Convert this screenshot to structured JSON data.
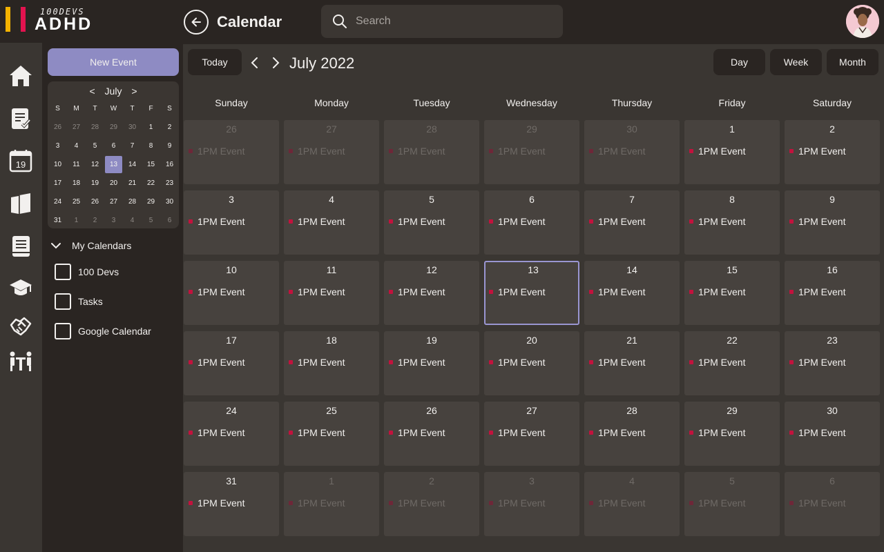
{
  "brand": {
    "small": "100DEVS",
    "big": "ADHD",
    "accent_yellow": "#f5b300",
    "accent_red": "#e3134f"
  },
  "header": {
    "title": "Calendar",
    "search_placeholder": "Search"
  },
  "rail": [
    "home-icon",
    "checklist-icon",
    "calendar-icon",
    "cards-icon",
    "book-icon",
    "graduation-cap-icon",
    "handshake-icon",
    "meeting-icon"
  ],
  "rail_calendar_number": "19",
  "sidebar": {
    "new_event": "New Event",
    "mini": {
      "month": "July",
      "prev": "<",
      "next": ">",
      "weekdays": [
        "S",
        "M",
        "T",
        "W",
        "T",
        "F",
        "S"
      ],
      "weeks": [
        [
          [
            "26",
            1
          ],
          [
            "27",
            1
          ],
          [
            "28",
            1
          ],
          [
            "29",
            1
          ],
          [
            "30",
            1
          ],
          [
            "1",
            0
          ],
          [
            "2",
            0
          ]
        ],
        [
          [
            "3",
            0
          ],
          [
            "4",
            0
          ],
          [
            "5",
            0
          ],
          [
            "6",
            0
          ],
          [
            "7",
            0
          ],
          [
            "8",
            0
          ],
          [
            "9",
            0
          ]
        ],
        [
          [
            "10",
            0
          ],
          [
            "11",
            0
          ],
          [
            "12",
            0
          ],
          [
            "13",
            2
          ],
          [
            "14",
            0
          ],
          [
            "15",
            0
          ],
          [
            "16",
            0
          ]
        ],
        [
          [
            "17",
            0
          ],
          [
            "18",
            0
          ],
          [
            "19",
            0
          ],
          [
            "20",
            0
          ],
          [
            "21",
            0
          ],
          [
            "22",
            0
          ],
          [
            "23",
            0
          ]
        ],
        [
          [
            "24",
            0
          ],
          [
            "25",
            0
          ],
          [
            "26",
            0
          ],
          [
            "27",
            0
          ],
          [
            "28",
            0
          ],
          [
            "29",
            0
          ],
          [
            "30",
            0
          ]
        ],
        [
          [
            "31",
            0
          ],
          [
            "1",
            1
          ],
          [
            "2",
            1
          ],
          [
            "3",
            1
          ],
          [
            "4",
            1
          ],
          [
            "5",
            1
          ],
          [
            "6",
            1
          ]
        ]
      ]
    },
    "my_calendars": "My Calendars",
    "calendars": [
      "100 Devs",
      "Tasks",
      "Google Calendar"
    ]
  },
  "toolbar": {
    "today": "Today",
    "month_title": "July 2022",
    "views": [
      "Day",
      "Week",
      "Month"
    ]
  },
  "weekdays": [
    "Sunday",
    "Monday",
    "Tuesday",
    "Wednesday",
    "Thursday",
    "Friday",
    "Saturday"
  ],
  "event_label": "1PM Event",
  "event_color": "#c2123d",
  "today_border": "#9a96d2",
  "weeks": [
    [
      [
        "26",
        1
      ],
      [
        "27",
        1
      ],
      [
        "28",
        1
      ],
      [
        "29",
        1
      ],
      [
        "30",
        1
      ],
      [
        "1",
        0
      ],
      [
        "2",
        0
      ]
    ],
    [
      [
        "3",
        0
      ],
      [
        "4",
        0
      ],
      [
        "5",
        0
      ],
      [
        "6",
        0
      ],
      [
        "7",
        0
      ],
      [
        "8",
        0
      ],
      [
        "9",
        0
      ]
    ],
    [
      [
        "10",
        0
      ],
      [
        "11",
        0
      ],
      [
        "12",
        0
      ],
      [
        "13",
        2
      ],
      [
        "14",
        0
      ],
      [
        "15",
        0
      ],
      [
        "16",
        0
      ]
    ],
    [
      [
        "17",
        0
      ],
      [
        "18",
        0
      ],
      [
        "19",
        0
      ],
      [
        "20",
        0
      ],
      [
        "21",
        0
      ],
      [
        "22",
        0
      ],
      [
        "23",
        0
      ]
    ],
    [
      [
        "24",
        0
      ],
      [
        "25",
        0
      ],
      [
        "26",
        0
      ],
      [
        "27",
        0
      ],
      [
        "28",
        0
      ],
      [
        "29",
        0
      ],
      [
        "30",
        0
      ]
    ],
    [
      [
        "31",
        0
      ],
      [
        "1",
        1
      ],
      [
        "2",
        1
      ],
      [
        "3",
        1
      ],
      [
        "4",
        1
      ],
      [
        "5",
        1
      ],
      [
        "6",
        1
      ]
    ]
  ]
}
